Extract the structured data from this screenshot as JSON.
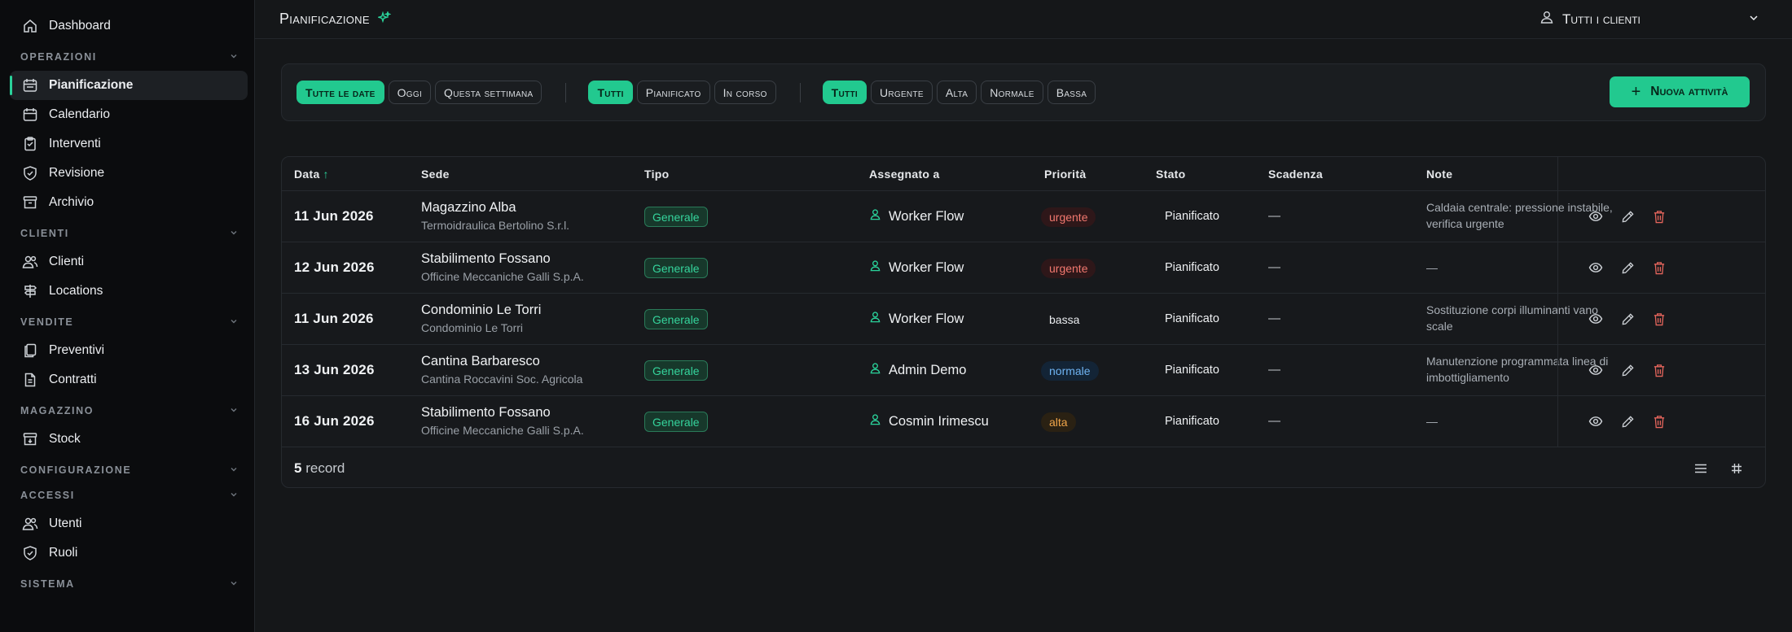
{
  "sidebar": {
    "top": {
      "label": "Dashboard",
      "icon": "home-icon"
    },
    "sections": [
      {
        "title": "Operazioni",
        "items": [
          {
            "label": "Pianificazione",
            "icon": "calendar-plan-icon",
            "active": true
          },
          {
            "label": "Calendario",
            "icon": "calendar-icon"
          },
          {
            "label": "Interventi",
            "icon": "clipboard-icon"
          },
          {
            "label": "Revisione",
            "icon": "shield-check-icon"
          },
          {
            "label": "Archivio",
            "icon": "archive-icon"
          }
        ]
      },
      {
        "title": "Clienti",
        "items": [
          {
            "label": "Clienti",
            "icon": "users-icon"
          },
          {
            "label": "Locations",
            "icon": "map-signpost-icon"
          }
        ]
      },
      {
        "title": "Vendite",
        "items": [
          {
            "label": "Preventivi",
            "icon": "document-copy-icon"
          },
          {
            "label": "Contratti",
            "icon": "document-icon"
          }
        ]
      },
      {
        "title": "Magazzino",
        "items": [
          {
            "label": "Stock",
            "icon": "archive-box-icon"
          }
        ]
      },
      {
        "title": "Configurazione",
        "items": []
      },
      {
        "title": "Accessi",
        "items": [
          {
            "label": "Utenti",
            "icon": "users-icon"
          },
          {
            "label": "Ruoli",
            "icon": "shield-check-icon"
          }
        ]
      },
      {
        "title": "Sistema",
        "items": []
      }
    ]
  },
  "header": {
    "title": "Pianificazione",
    "client_filter": "Tutti i clienti"
  },
  "filters": {
    "date": [
      "Tutte le date",
      "Oggi",
      "Questa settimana"
    ],
    "status": [
      "Tutti",
      "Pianificato",
      "In corso"
    ],
    "priority": [
      "Tutti",
      "Urgente",
      "Alta",
      "Normale",
      "Bassa"
    ],
    "new_button": "Nuova attività"
  },
  "table": {
    "columns": {
      "data": "Data",
      "sede": "Sede",
      "tipo": "Tipo",
      "assegnato": "Assegnato a",
      "priorita": "Priorità",
      "stato": "Stato",
      "scadenza": "Scadenza",
      "note": "Note"
    },
    "rows": [
      {
        "date": "11 Jun 2026",
        "site": "Magazzino Alba",
        "company": "Termoidraulica Bertolino S.r.l.",
        "type": "Generale",
        "assignee": "Worker Flow",
        "priority": "urgente",
        "status": "Pianificato",
        "deadline": "—",
        "note": "Caldaia centrale: pressione instabile, verifica urgente"
      },
      {
        "date": "12 Jun 2026",
        "site": "Stabilimento Fossano",
        "company": "Officine Meccaniche Galli S.p.A.",
        "type": "Generale",
        "assignee": "Worker Flow",
        "priority": "urgente",
        "status": "Pianificato",
        "deadline": "—",
        "note": "—"
      },
      {
        "date": "11 Jun 2026",
        "site": "Condominio Le Torri",
        "company": "Condominio Le Torri",
        "type": "Generale",
        "assignee": "Worker Flow",
        "priority": "bassa",
        "status": "Pianificato",
        "deadline": "—",
        "note": "Sostituzione corpi illuminanti vano scale"
      },
      {
        "date": "13 Jun 2026",
        "site": "Cantina Barbaresco",
        "company": "Cantina Roccavini Soc. Agricola",
        "type": "Generale",
        "assignee": "Admin Demo",
        "priority": "normale",
        "status": "Pianificato",
        "deadline": "—",
        "note": "Manutenzione programmata linea di imbottigliamento"
      },
      {
        "date": "16 Jun 2026",
        "site": "Stabilimento Fossano",
        "company": "Officine Meccaniche Galli S.p.A.",
        "type": "Generale",
        "assignee": "Cosmin Irimescu",
        "priority": "alta",
        "status": "Pianificato",
        "deadline": "—",
        "note": "—"
      }
    ],
    "footer": {
      "count": "5",
      "count_label": "record"
    }
  },
  "colors": {
    "accent": "#22c98f",
    "background": "#151719",
    "sidebar": "#0b0c0e",
    "danger": "#e5655c"
  }
}
